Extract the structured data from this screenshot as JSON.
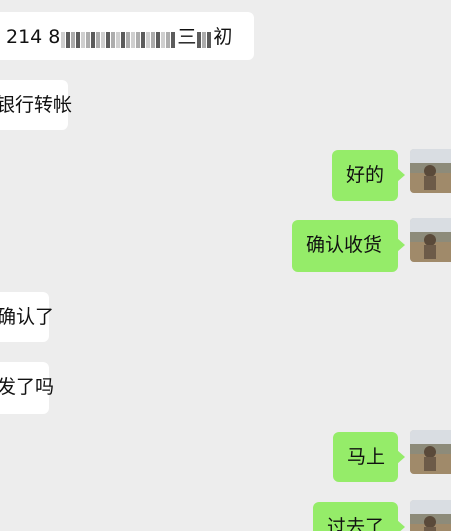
{
  "messages": [
    {
      "side": "in",
      "pre": "214 8",
      "post": "三",
      "tail": "初"
    },
    {
      "side": "in",
      "text": "银行转帐"
    },
    {
      "side": "out",
      "text": "好的"
    },
    {
      "side": "out",
      "text": "确认收货"
    },
    {
      "side": "in",
      "text": "确认了"
    },
    {
      "side": "in",
      "text": "发了吗"
    },
    {
      "side": "out",
      "text": "马上"
    },
    {
      "side": "out",
      "text": "过去了"
    }
  ],
  "colors": {
    "background": "#ededed",
    "incoming_bubble": "#ffffff",
    "outgoing_bubble": "#95ec69"
  },
  "icons": [
    "user-avatar-photo"
  ]
}
